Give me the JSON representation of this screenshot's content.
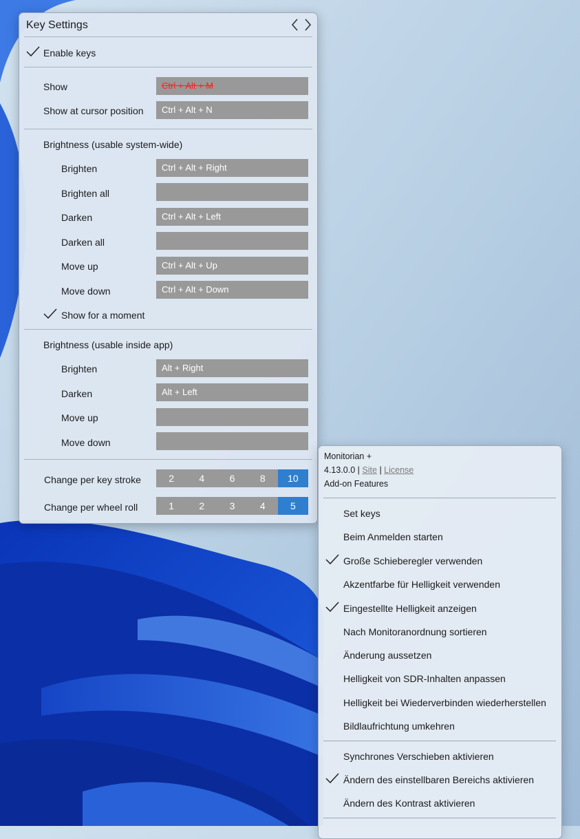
{
  "key_settings": {
    "title": "Key Settings",
    "enable_keys": "Enable keys",
    "show_label": "Show",
    "show_value": "Ctrl + Alt + M",
    "cursor_label": "Show at cursor position",
    "cursor_value": "Ctrl + Alt + N",
    "system_section": "Brightness (usable system-wide)",
    "system_rows": [
      {
        "label": "Brighten",
        "value": "Ctrl + Alt + Right"
      },
      {
        "label": "Brighten all",
        "value": ""
      },
      {
        "label": "Darken",
        "value": "Ctrl + Alt + Left"
      },
      {
        "label": "Darken all",
        "value": ""
      },
      {
        "label": "Move up",
        "value": "Ctrl + Alt + Up"
      },
      {
        "label": "Move down",
        "value": "Ctrl + Alt + Down"
      }
    ],
    "show_moment": "Show for a moment",
    "app_section": "Brightness (usable inside app)",
    "app_rows": [
      {
        "label": "Brighten",
        "value": "Alt + Right"
      },
      {
        "label": "Darken",
        "value": "Alt + Left"
      },
      {
        "label": "Move up",
        "value": ""
      },
      {
        "label": "Move down",
        "value": ""
      }
    ],
    "keystroke_label": "Change per key stroke",
    "keystroke_options": [
      "2",
      "4",
      "6",
      "8",
      "10"
    ],
    "keystroke_selected": "10",
    "wheel_label": "Change per wheel roll",
    "wheel_options": [
      "1",
      "2",
      "3",
      "4",
      "5"
    ],
    "wheel_selected": "5"
  },
  "menu": {
    "app_name": "Monitorian +",
    "version": "4.13.0.0",
    "divider": "|",
    "site": "Site",
    "license": "License",
    "addon": "Add-on Features",
    "items": [
      {
        "label": "Set keys",
        "checked": false
      },
      {
        "label": "Beim Anmelden starten",
        "checked": false
      },
      {
        "label": "Große Schieberegler verwenden",
        "checked": true
      },
      {
        "label": "Akzentfarbe für Helligkeit verwenden",
        "checked": false
      },
      {
        "label": "Eingestellte Helligkeit anzeigen",
        "checked": true
      },
      {
        "label": "Nach Monitoranordnung sortieren",
        "checked": false
      },
      {
        "label": "Änderung aussetzen",
        "checked": false
      },
      {
        "label": "Helligkeit von SDR-Inhalten anpassen",
        "checked": false
      },
      {
        "label": "Helligkeit bei Wiederverbinden wiederherstellen",
        "checked": false
      },
      {
        "label": "Bildlaufrichtung umkehren",
        "checked": false
      }
    ],
    "items2": [
      {
        "label": "Synchrones Verschieben aktivieren",
        "checked": false
      },
      {
        "label": "Ändern des einstellbaren Bereichs aktivieren",
        "checked": true
      },
      {
        "label": "Ändern des Kontrast aktivieren",
        "checked": false
      }
    ]
  },
  "colors": {
    "accent": "#2f7fce",
    "field_bg": "#999999",
    "conflict_text": "#ff2020"
  }
}
